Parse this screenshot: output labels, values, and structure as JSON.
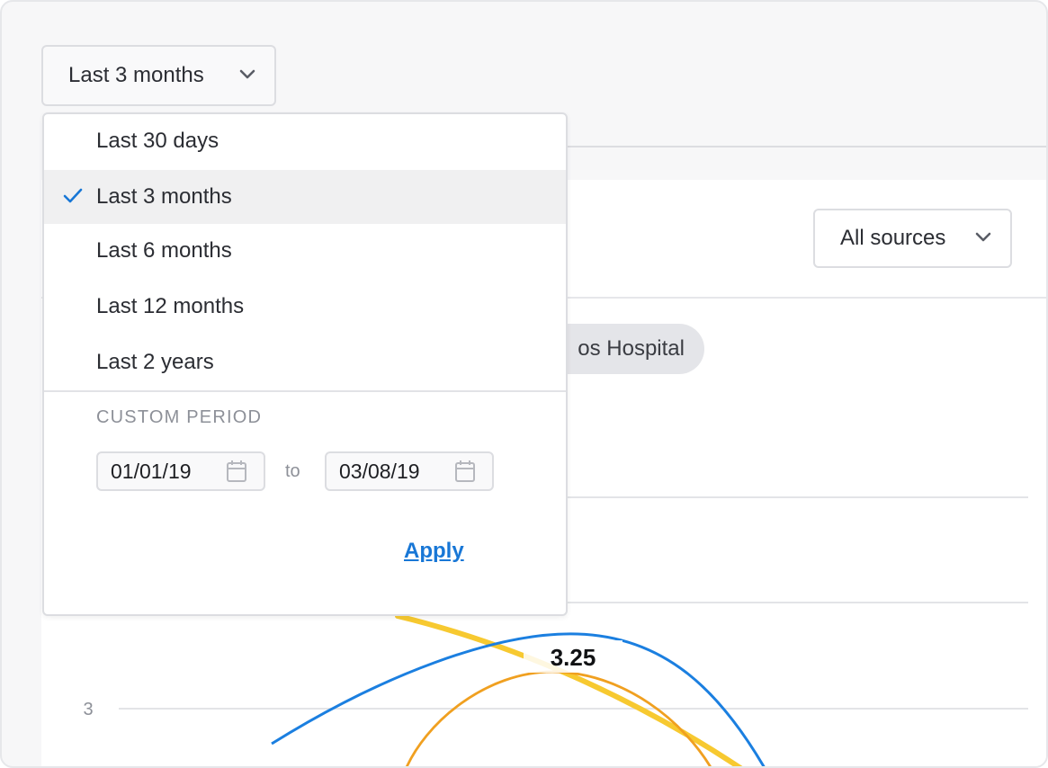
{
  "period_select": {
    "value": "Last 3 months"
  },
  "sources_select": {
    "value": "All sources"
  },
  "filter_chip": {
    "label": "os Hospital"
  },
  "dropdown": {
    "options": [
      {
        "label": "Last 30 days",
        "selected": false
      },
      {
        "label": "Last 3 months",
        "selected": true
      },
      {
        "label": "Last 6 months",
        "selected": false
      },
      {
        "label": "Last 12 months",
        "selected": false
      },
      {
        "label": "Last 2 years",
        "selected": false
      }
    ],
    "custom_period_label": "CUSTOM PERIOD",
    "from_date": "01/01/19",
    "to_label": "to",
    "to_date": "03/08/19",
    "apply_label": "Apply"
  },
  "colors": {
    "accent": "#1877d6",
    "series_blue": "#1b7fe0",
    "series_orange": "#f0a020",
    "series_yellow": "#f7c930",
    "grid": "#e3e4e7"
  },
  "chart_data": {
    "type": "line",
    "ytick_labels": [
      "3"
    ],
    "annotations": [
      {
        "text": "3.25"
      }
    ]
  }
}
